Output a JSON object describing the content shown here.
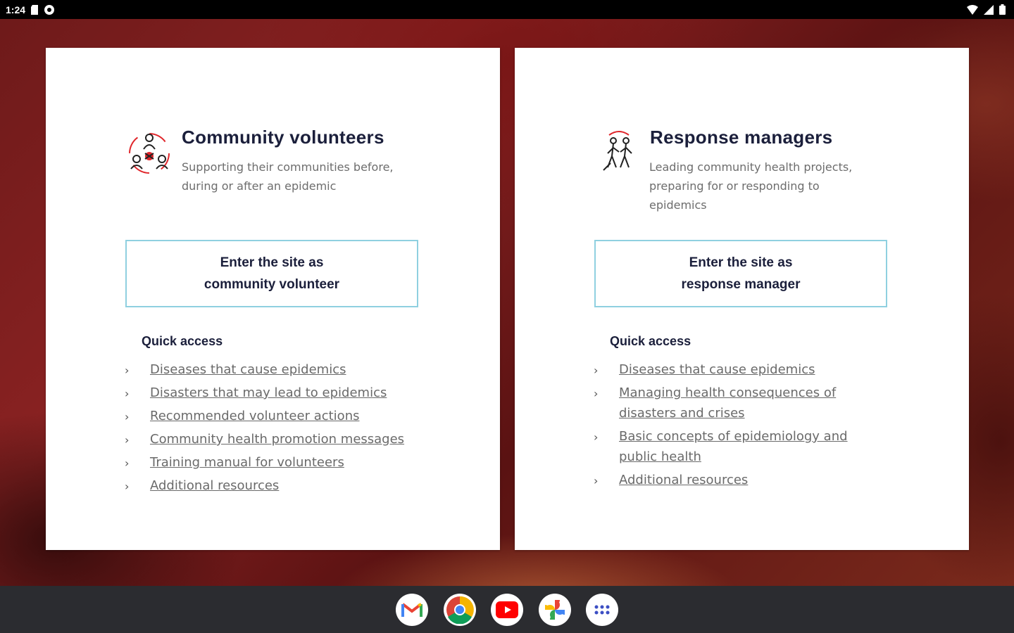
{
  "status_bar": {
    "time": "1:24"
  },
  "cards": {
    "community": {
      "title": "Community volunteers",
      "description": "Supporting their communities before, during or after an epidemic",
      "button_line1": "Enter the site as",
      "button_line2": "community volunteer",
      "quick_access_title": "Quick access",
      "links": [
        "Diseases that cause epidemics",
        "Disasters that may lead to epidemics",
        "Recommended volunteer actions",
        "Community health promotion messages",
        "Training manual for volunteers",
        "Additional resources"
      ]
    },
    "managers": {
      "title": "Response managers",
      "description": "Leading community health projects, preparing for or responding to epidemics",
      "button_line1": "Enter the site as",
      "button_line2": "response manager",
      "quick_access_title": "Quick access",
      "links": [
        "Diseases that cause epidemics",
        "Managing health consequences of disasters and crises",
        "Basic concepts of epidemiology and public health",
        "Additional resources"
      ]
    }
  },
  "colors": {
    "accent_border": "#8fd0e0",
    "title": "#1b1f3b",
    "link": "#6a6a6a",
    "icon_red": "#e0262b"
  },
  "dock": {
    "apps": [
      "gmail-icon",
      "chrome-icon",
      "youtube-icon",
      "photos-icon",
      "app-drawer-icon"
    ]
  }
}
